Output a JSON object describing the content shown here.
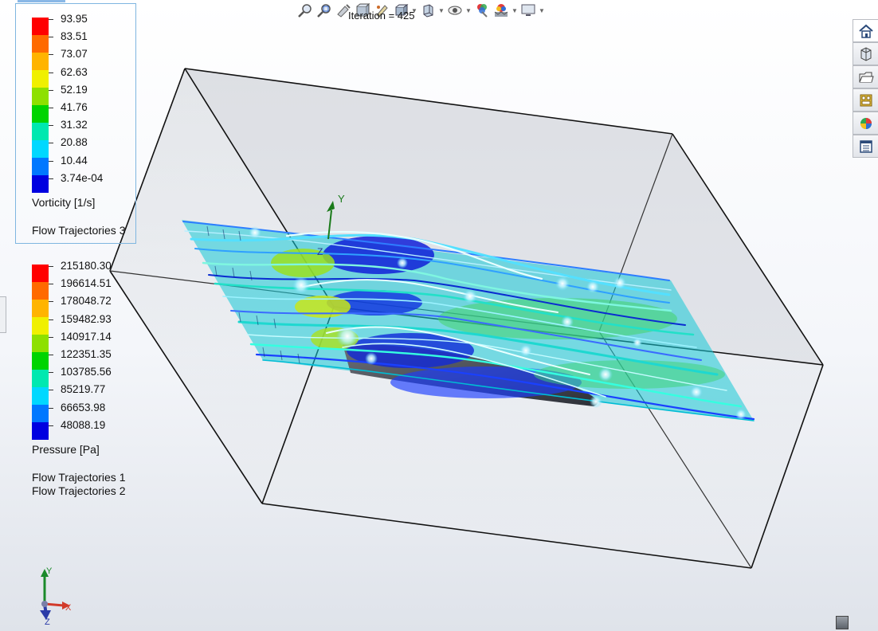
{
  "toolbar": {
    "iteration": "Iteration = 425",
    "buttons": [
      "zoom-to-fit-icon",
      "zoom-to-area-icon",
      "previous-view-icon",
      "section-view-icon",
      "dynamic-annotation-icon",
      "view-orientation-icon",
      "display-style-icon",
      "hide-show-icon",
      "edit-appearance-icon",
      "apply-scene-icon",
      "view-settings-icon"
    ]
  },
  "legend_vorticity": {
    "values": [
      "93.95",
      "83.51",
      "73.07",
      "62.63",
      "52.19",
      "41.76",
      "31.32",
      "20.88",
      "10.44",
      "3.74e-04"
    ],
    "colors": [
      "#ff0000",
      "#ff6a00",
      "#ffb400",
      "#f0f000",
      "#8ee000",
      "#00d400",
      "#00e8b0",
      "#00d8ff",
      "#0078ff",
      "#0000e0"
    ],
    "quantity": "Vorticity [1/s]",
    "source": "Flow Trajectories 3"
  },
  "legend_pressure": {
    "values": [
      "215180.30",
      "196614.51",
      "178048.72",
      "159482.93",
      "140917.14",
      "122351.35",
      "103785.56",
      "85219.77",
      "66653.98",
      "48088.19"
    ],
    "colors": [
      "#ff0000",
      "#ff6a00",
      "#ffb400",
      "#f0f000",
      "#8ee000",
      "#00d400",
      "#00e8b0",
      "#00d8ff",
      "#0078ff",
      "#0000e0"
    ],
    "quantity": "Pressure [Pa]",
    "sources": [
      "Flow Trajectories 1",
      "Flow Trajectories 2"
    ]
  },
  "model_axis": {
    "y": "Y",
    "z": "Z"
  },
  "triad": {
    "x": "X",
    "y": "Y",
    "z": "Z"
  },
  "task_pane_tabs": [
    "home-icon",
    "design-library-icon",
    "file-explorer-icon",
    "view-palette-icon",
    "appearances-icon",
    "custom-properties-icon"
  ]
}
